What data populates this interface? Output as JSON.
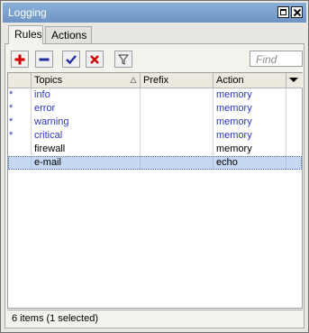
{
  "window": {
    "title": "Logging"
  },
  "tabs": [
    {
      "label": "Rules",
      "active": true
    },
    {
      "label": "Actions",
      "active": false
    }
  ],
  "toolbar": {
    "find_placeholder": "Find",
    "buttons": [
      "add-icon",
      "remove-icon",
      "enable-icon",
      "disable-icon",
      "filter-icon"
    ]
  },
  "table": {
    "columns": {
      "topics": "Topics",
      "prefix": "Prefix",
      "action": "Action"
    },
    "rows": [
      {
        "mark": "*",
        "topics": "info",
        "prefix": "",
        "action": "memory"
      },
      {
        "mark": "*",
        "topics": "error",
        "prefix": "",
        "action": "memory"
      },
      {
        "mark": "*",
        "topics": "warning",
        "prefix": "",
        "action": "memory"
      },
      {
        "mark": "*",
        "topics": "critical",
        "prefix": "",
        "action": "memory"
      },
      {
        "mark": "",
        "topics": "firewall",
        "prefix": "",
        "action": "memory"
      },
      {
        "mark": "",
        "topics": "e-mail",
        "prefix": "",
        "action": "echo"
      }
    ]
  },
  "status": {
    "text": "6 items (1 selected)"
  },
  "colors": {
    "titlebar": "#7aa2cf",
    "default_row_text": "#2e36c0",
    "selected_row": "#c6d8f2"
  }
}
